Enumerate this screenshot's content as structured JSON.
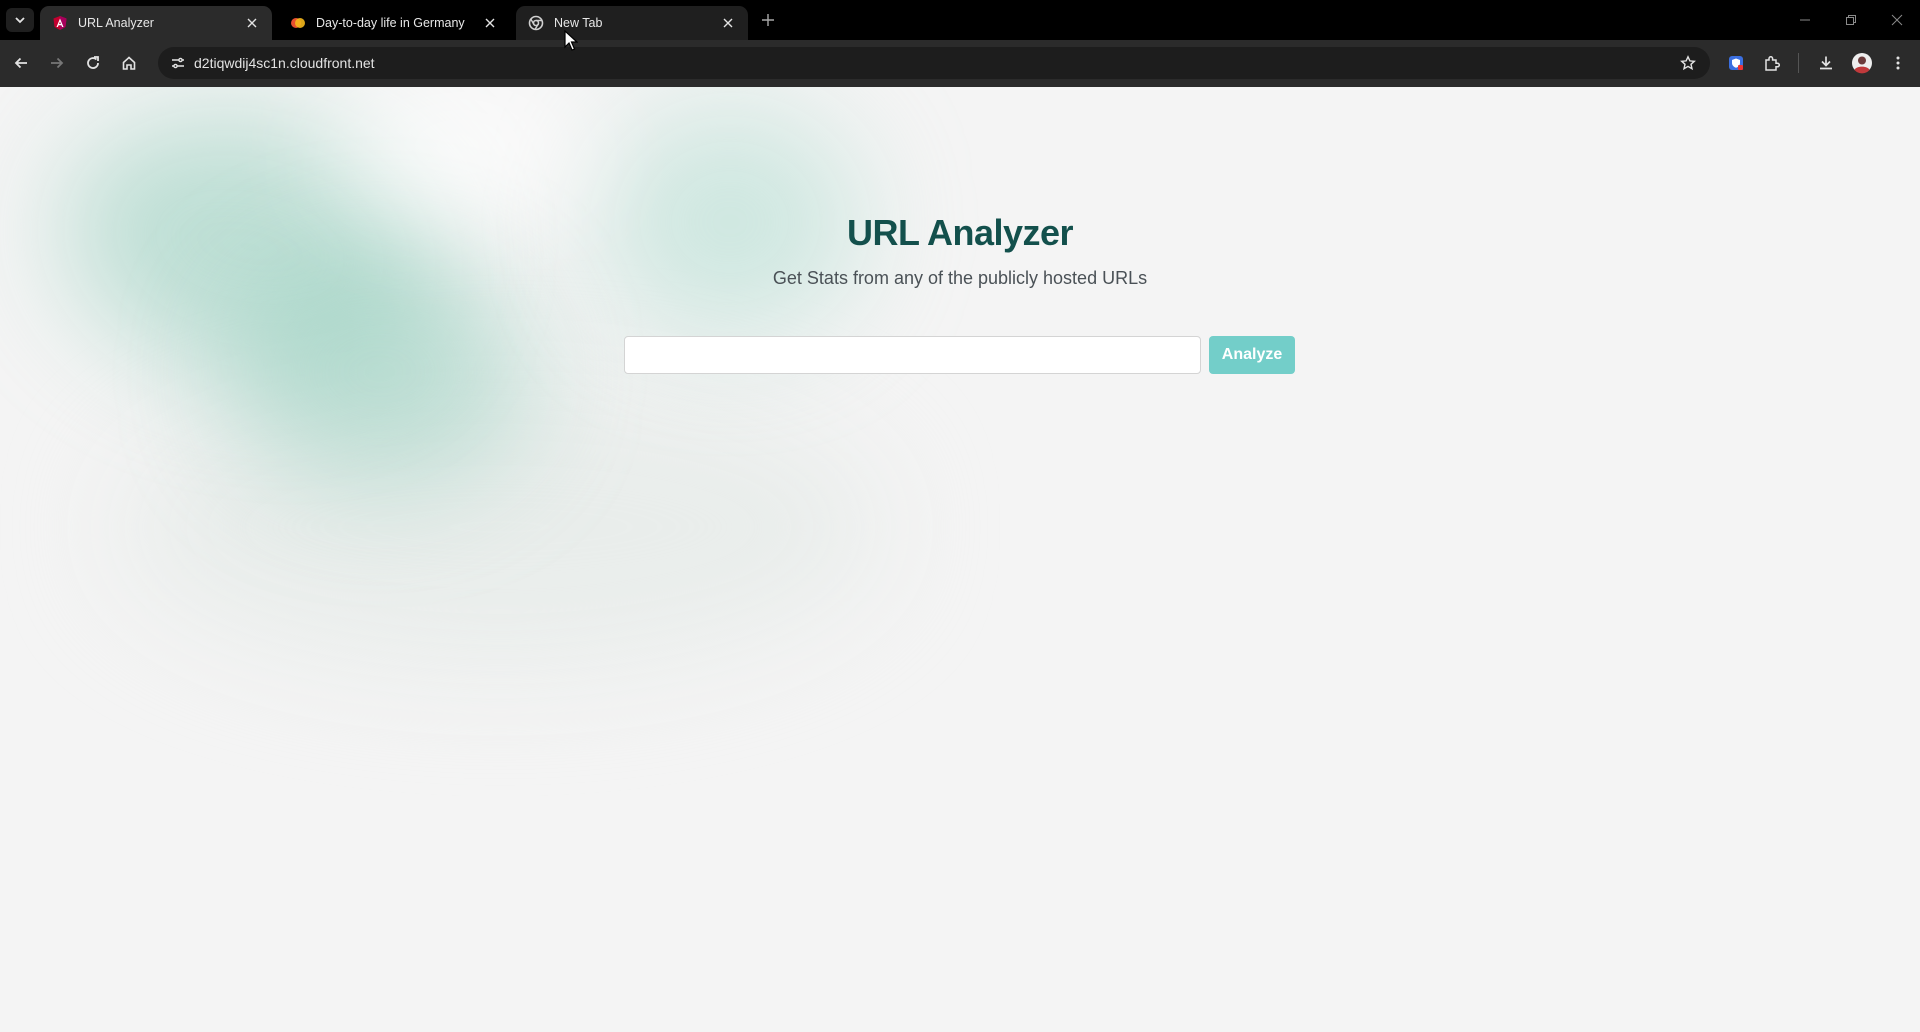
{
  "browser": {
    "tabs": [
      {
        "title": "URL Analyzer",
        "favicon": "angular-icon",
        "state": "active"
      },
      {
        "title": "Day-to-day life in Germany",
        "favicon": "colorful-circle-icon",
        "state": "inactive"
      },
      {
        "title": "New Tab",
        "favicon": "chrome-icon",
        "state": "hovered"
      }
    ],
    "address_bar": {
      "url": "d2tiqwdij4sc1n.cloudfront.net"
    },
    "colors": {
      "tabstrip": "#000000",
      "toolbar": "#2b2b2b",
      "omnibox": "#1d1d1d"
    }
  },
  "page": {
    "title": "URL Analyzer",
    "subtitle": "Get Stats from any of the publicly hosted URLs",
    "search": {
      "value": "",
      "placeholder": ""
    },
    "analyze_label": "Analyze",
    "colors": {
      "title": "#13504c",
      "button": "#73cec9",
      "background": "#f4f4f4",
      "accent_blob": "#92cdbc"
    }
  }
}
